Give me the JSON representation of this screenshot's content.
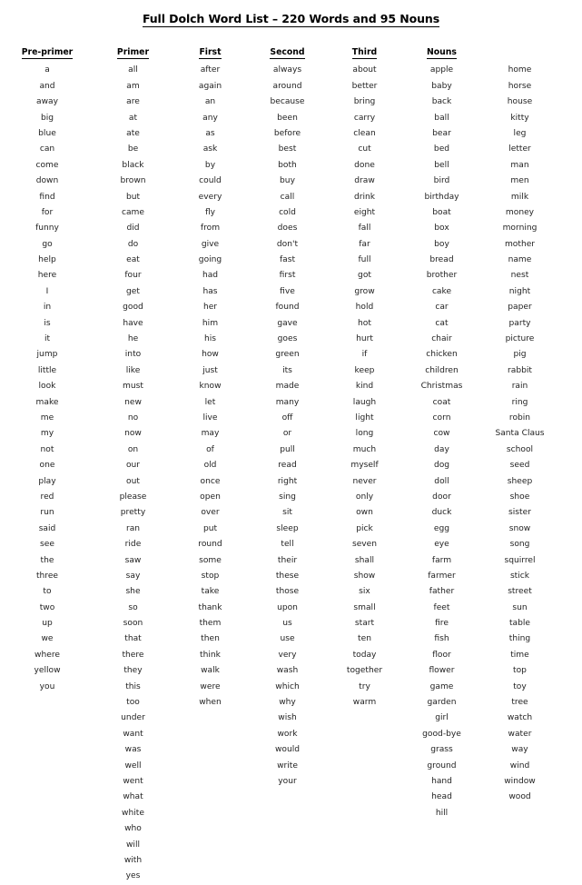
{
  "document": {
    "title": "Full Dolch Word List – 220 Words and 95 Nouns"
  },
  "columns": [
    {
      "header": "Pre-primer",
      "words": [
        "a",
        "and",
        "away",
        "big",
        "blue",
        "can",
        "come",
        "down",
        "find",
        "for",
        "funny",
        "go",
        "help",
        "here",
        "I",
        "in",
        "is",
        "it",
        "jump",
        "little",
        "look",
        "make",
        "me",
        "my",
        "not",
        "one",
        "play",
        "red",
        "run",
        "said",
        "see",
        "the",
        "three",
        "to",
        "two",
        "up",
        "we",
        "where",
        "yellow",
        "you"
      ]
    },
    {
      "header": "Primer",
      "words": [
        "all",
        "am",
        "are",
        "at",
        "ate",
        "be",
        "black",
        "brown",
        "but",
        "came",
        "did",
        "do",
        "eat",
        "four",
        "get",
        "good",
        "have",
        "he",
        "into",
        "like",
        "must",
        "new",
        "no",
        "now",
        "on",
        "our",
        "out",
        "please",
        "pretty",
        "ran",
        "ride",
        "saw",
        "say",
        "she",
        "so",
        "soon",
        "that",
        "there",
        "they",
        "this",
        "too",
        "under",
        "want",
        "was",
        "well",
        "went",
        "what",
        "white",
        "who",
        "will",
        "with",
        "yes"
      ]
    },
    {
      "header": "First",
      "words": [
        "after",
        "again",
        "an",
        "any",
        "as",
        "ask",
        "by",
        "could",
        "every",
        "fly",
        "from",
        "give",
        "going",
        "had",
        "has",
        "her",
        "him",
        "his",
        "how",
        "just",
        "know",
        "let",
        "live",
        "may",
        "of",
        "old",
        "once",
        "open",
        "over",
        "put",
        "round",
        "some",
        "stop",
        "take",
        "thank",
        "them",
        "then",
        "think",
        "walk",
        "were",
        "when"
      ]
    },
    {
      "header": "Second",
      "words": [
        "always",
        "around",
        "because",
        "been",
        "before",
        "best",
        "both",
        "buy",
        "call",
        "cold",
        "does",
        "don't",
        "fast",
        "first",
        "five",
        "found",
        "gave",
        "goes",
        "green",
        "its",
        "made",
        "many",
        "off",
        "or",
        "pull",
        "read",
        "right",
        "sing",
        "sit",
        "sleep",
        "tell",
        "their",
        "these",
        "those",
        "upon",
        "us",
        "use",
        "very",
        "wash",
        "which",
        "why",
        "wish",
        "work",
        "would",
        "write",
        "your"
      ]
    },
    {
      "header": "Third",
      "words": [
        "about",
        "better",
        "bring",
        "carry",
        "clean",
        "cut",
        "done",
        "draw",
        "drink",
        "eight",
        "fall",
        "far",
        "full",
        "got",
        "grow",
        "hold",
        "hot",
        "hurt",
        "if",
        "keep",
        "kind",
        "laugh",
        "light",
        "long",
        "much",
        "myself",
        "never",
        "only",
        "own",
        "pick",
        "seven",
        "shall",
        "show",
        "six",
        "small",
        "start",
        "ten",
        "today",
        "together",
        "try",
        "warm"
      ]
    },
    {
      "header": "Nouns",
      "words": [
        "apple",
        "baby",
        "back",
        "ball",
        "bear",
        "bed",
        "bell",
        "bird",
        "birthday",
        "boat",
        "box",
        "boy",
        "bread",
        "brother",
        "cake",
        "car",
        "cat",
        "chair",
        "chicken",
        "children",
        "Christmas",
        "coat",
        "corn",
        "cow",
        "day",
        "dog",
        "doll",
        "door",
        "duck",
        "egg",
        "eye",
        "farm",
        "farmer",
        "father",
        "feet",
        "fire",
        "fish",
        "floor",
        "flower",
        "game",
        "garden",
        "girl",
        "good-bye",
        "grass",
        "ground",
        "hand",
        "head",
        "hill"
      ]
    },
    {
      "header": "",
      "words": [
        "home",
        "horse",
        "house",
        "kitty",
        "leg",
        "letter",
        "man",
        "men",
        "milk",
        "money",
        "morning",
        "mother",
        "name",
        "nest",
        "night",
        "paper",
        "party",
        "picture",
        "pig",
        "rabbit",
        "rain",
        "ring",
        "robin",
        "Santa Claus",
        "school",
        "seed",
        "sheep",
        "shoe",
        "sister",
        "snow",
        "song",
        "squirrel",
        "stick",
        "street",
        "sun",
        "table",
        "thing",
        "time",
        "top",
        "toy",
        "tree",
        "watch",
        "water",
        "way",
        "wind",
        "window",
        "wood"
      ]
    }
  ]
}
